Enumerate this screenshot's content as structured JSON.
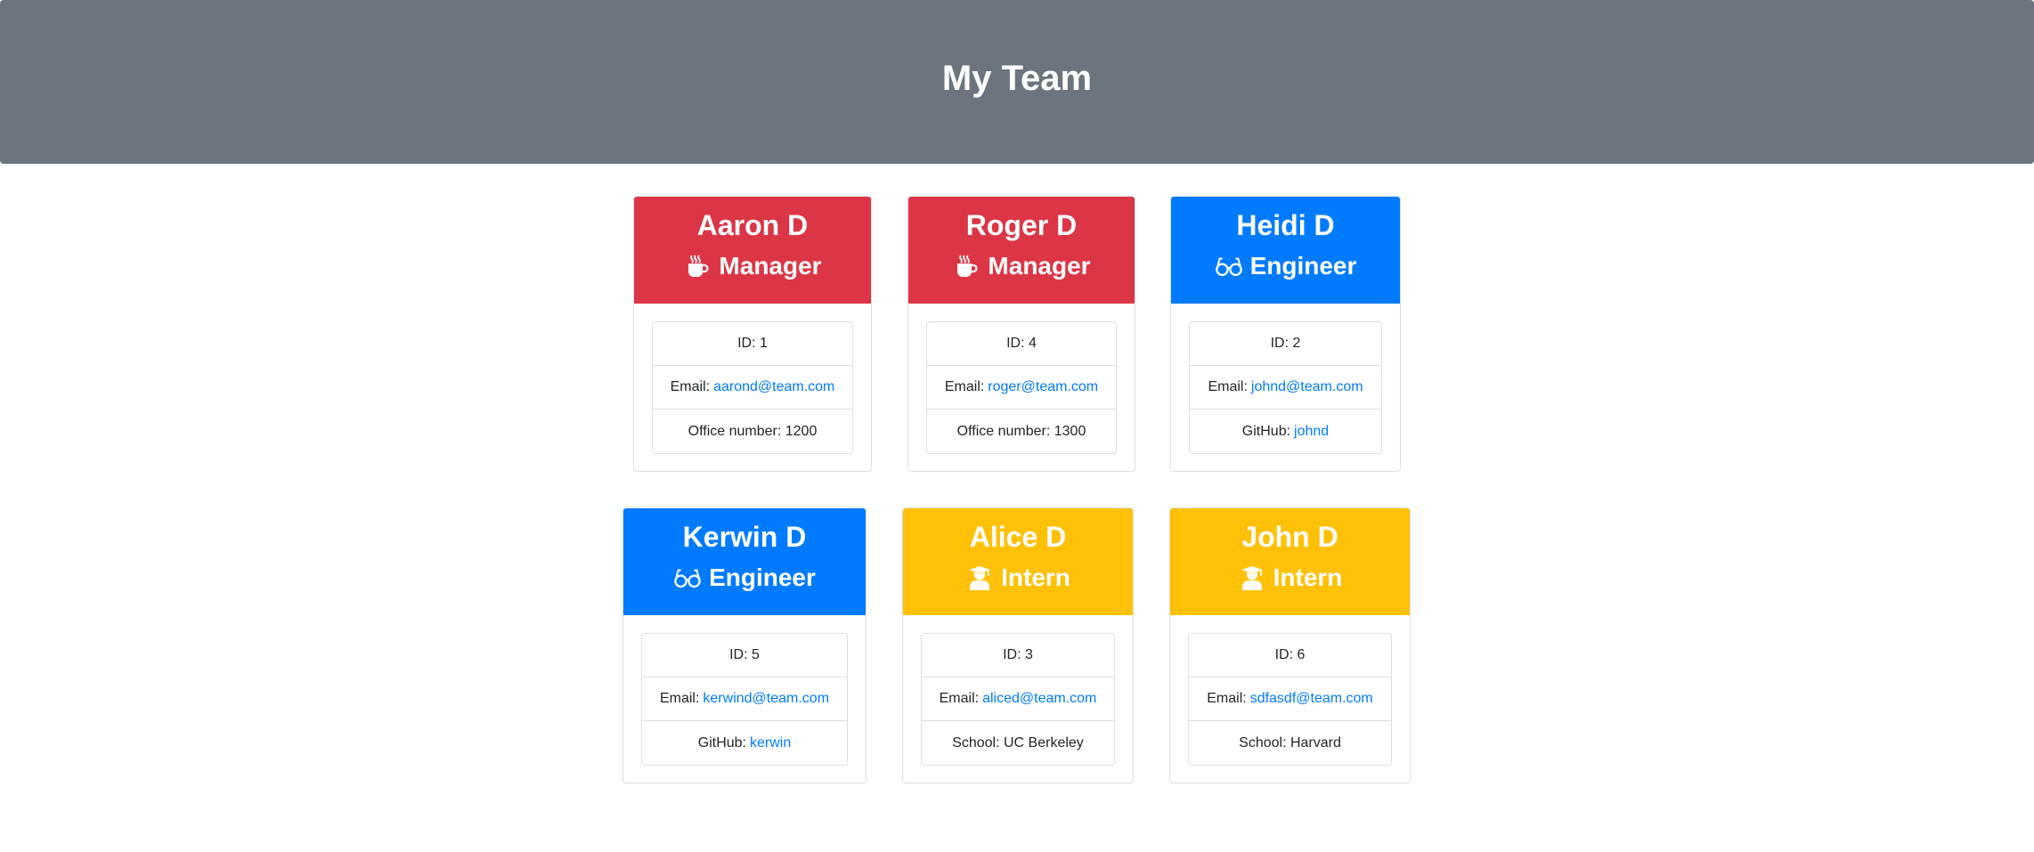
{
  "header": {
    "title": "My Team"
  },
  "colors": {
    "manager": "#dc3545",
    "engineer": "#007bff",
    "intern": "#ffc107",
    "link": "#007bff"
  },
  "employees": [
    {
      "name": "Aaron D",
      "role": "Manager",
      "icon": "coffee-icon",
      "id_label": "ID: 1",
      "email_label": "Email:",
      "email": "aarond@team.com",
      "extra_label": "Office number: 1200",
      "extra_link": ""
    },
    {
      "name": "Roger D",
      "role": "Manager",
      "icon": "coffee-icon",
      "id_label": "ID: 4",
      "email_label": "Email:",
      "email": "roger@team.com",
      "extra_label": "Office number: 1300",
      "extra_link": ""
    },
    {
      "name": "Heidi D",
      "role": "Engineer",
      "icon": "glasses-icon",
      "id_label": "ID: 2",
      "email_label": "Email:",
      "email": "johnd@team.com",
      "extra_label": "GitHub:",
      "extra_link": "johnd"
    },
    {
      "name": "Kerwin D",
      "role": "Engineer",
      "icon": "glasses-icon",
      "id_label": "ID: 5",
      "email_label": "Email:",
      "email": "kerwind@team.com",
      "extra_label": "GitHub:",
      "extra_link": "kerwin"
    },
    {
      "name": "Alice D",
      "role": "Intern",
      "icon": "graduate-icon",
      "id_label": "ID: 3",
      "email_label": "Email:",
      "email": "aliced@team.com",
      "extra_label": "School: UC Berkeley",
      "extra_link": ""
    },
    {
      "name": "John D",
      "role": "Intern",
      "icon": "graduate-icon",
      "id_label": "ID: 6",
      "email_label": "Email:",
      "email": "sdfasdf@team.com",
      "extra_label": "School: Harvard",
      "extra_link": ""
    }
  ]
}
